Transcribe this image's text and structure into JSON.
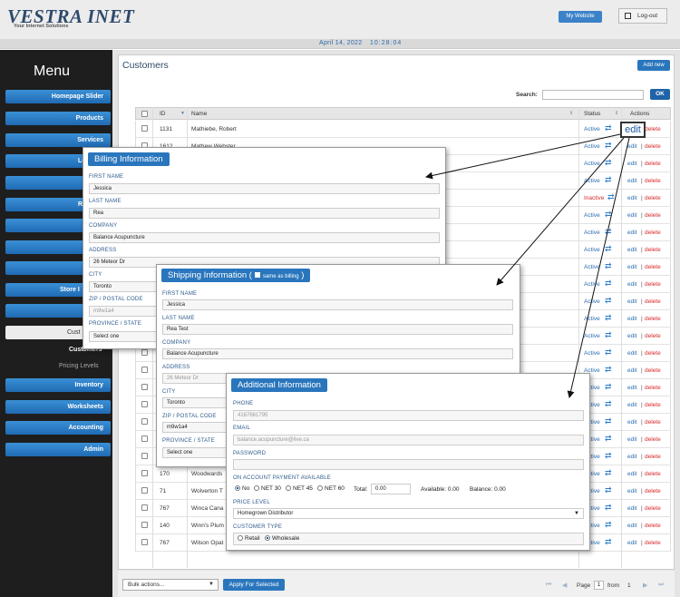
{
  "header": {
    "logo": "VESTRA INET",
    "tagline": "Your Internet Solutions",
    "my_website": "My Website",
    "logout": "Log-out",
    "date": "April 14, 2022",
    "time": "10:28:04"
  },
  "sidebar": {
    "title": "Menu",
    "items": [
      {
        "label": "Homepage Slider"
      },
      {
        "label": "Products"
      },
      {
        "label": "Services"
      },
      {
        "label": "Lo"
      },
      {
        "label": ""
      },
      {
        "label": "Re"
      },
      {
        "label": ""
      },
      {
        "label": ""
      },
      {
        "label": ""
      },
      {
        "label": "Store I"
      },
      {
        "label": ""
      },
      {
        "label": "Cust"
      },
      {
        "label": "Customers"
      },
      {
        "label": "Pricing Levels"
      },
      {
        "label": "Inventory"
      },
      {
        "label": "Worksheets"
      },
      {
        "label": "Accounting"
      },
      {
        "label": "Admin"
      }
    ]
  },
  "page": {
    "title": "Customers",
    "add_new": "Add new",
    "search_label": "Search:",
    "ok": "OK",
    "edit_callout": "edit",
    "columns": {
      "id": "ID",
      "name": "Name",
      "status": "Status",
      "actions": "Actions"
    },
    "action_edit": "edit",
    "action_sep": "|",
    "action_delete": "delete",
    "rows": [
      {
        "id": "1131",
        "name": "Mathiebe, Robert",
        "status": "Active"
      },
      {
        "id": "1612",
        "name": "Mathew Webster",
        "status": "Active"
      },
      {
        "id": "",
        "name": "",
        "status": "Active"
      },
      {
        "id": "",
        "name": "",
        "status": "Active"
      },
      {
        "id": "",
        "name": "",
        "status": "Inactive"
      },
      {
        "id": "",
        "name": "",
        "status": "Active"
      },
      {
        "id": "",
        "name": "",
        "status": "Active"
      },
      {
        "id": "",
        "name": "",
        "status": "Active"
      },
      {
        "id": "",
        "name": "",
        "status": "Active"
      },
      {
        "id": "",
        "name": "",
        "status": "Active"
      },
      {
        "id": "",
        "name": "",
        "status": "Active"
      },
      {
        "id": "",
        "name": "",
        "status": "Active"
      },
      {
        "id": "",
        "name": "",
        "status": "Active"
      },
      {
        "id": "",
        "name": "",
        "status": "Active"
      },
      {
        "id": "",
        "name": "",
        "status": "Active"
      },
      {
        "id": "",
        "name": "",
        "status": "Active"
      },
      {
        "id": "",
        "name": "",
        "status": "Active"
      },
      {
        "id": "",
        "name": "",
        "status": "Active"
      },
      {
        "id": "",
        "name": "",
        "status": "Active"
      },
      {
        "id": "",
        "name": "",
        "status": "Active"
      },
      {
        "id": "170",
        "name": "Woodwards",
        "status": "Active"
      },
      {
        "id": "71",
        "name": "Wolverton T",
        "status": "Active"
      },
      {
        "id": "767",
        "name": "Winca Cana",
        "status": "Active"
      },
      {
        "id": "140",
        "name": "Winn's Plum",
        "status": "Active"
      },
      {
        "id": "767",
        "name": "Wilson Opat",
        "status": "Active"
      }
    ],
    "bulk_actions": "Bulk actions...",
    "apply": "Apply For Selected",
    "pager": {
      "page_label": "Page",
      "page": "1",
      "from_label": "from",
      "total": "1"
    }
  },
  "billing": {
    "title": "Billing Information",
    "fields": [
      {
        "label": "FIRST NAME",
        "value": "Jessica"
      },
      {
        "label": "LAST NAME",
        "value": "Rea"
      },
      {
        "label": "COMPANY",
        "value": "Balance Acupuncture"
      },
      {
        "label": "ADDRESS",
        "value": "26 Meteor Dr"
      },
      {
        "label": "CITY",
        "value": "Toronto"
      },
      {
        "label": "ZIP / POSTAL CODE",
        "value": "m9w1a4"
      },
      {
        "label": "PROVINCE / STATE",
        "value": "Select one"
      }
    ]
  },
  "shipping": {
    "title": "Shipping Information (",
    "same_as_billing": "same as billing",
    "close_paren": ")",
    "fields": [
      {
        "label": "FIRST NAME",
        "value": "Jessica"
      },
      {
        "label": "LAST NAME",
        "value": "Rea Test"
      },
      {
        "label": "COMPANY",
        "value": "Balance Acupuncture"
      },
      {
        "label": "ADDRESS",
        "value": "26 Meteor Dr"
      },
      {
        "label": "CITY",
        "value": "Toronto"
      },
      {
        "label": "ZIP / POSTAL CODE",
        "value": "m9w1a4"
      },
      {
        "label": "PROVINCE / STATE",
        "value": "Select one"
      }
    ]
  },
  "additional": {
    "title": "Additional Information",
    "phone_label": "PHONE",
    "phone": "4167661795",
    "email_label": "EMAIL",
    "email": "balance.acupuncture@live.ca",
    "password_label": "PASSWORD",
    "password": "",
    "on_account_label": "ON ACCOUNT PAYMENT AVAILABLE",
    "options": [
      "No",
      "NET 30",
      "NET 45",
      "NET 60"
    ],
    "total_label": "Total:",
    "total": "0.00",
    "available": "Available: 0.00",
    "balance": "Balance: 0.00",
    "price_level_label": "PRICE LEVEL",
    "price_level": "Homegrown Distributor",
    "customer_type_label": "CUSTOMER TYPE",
    "types": [
      "Retail",
      "Wholesale"
    ]
  }
}
